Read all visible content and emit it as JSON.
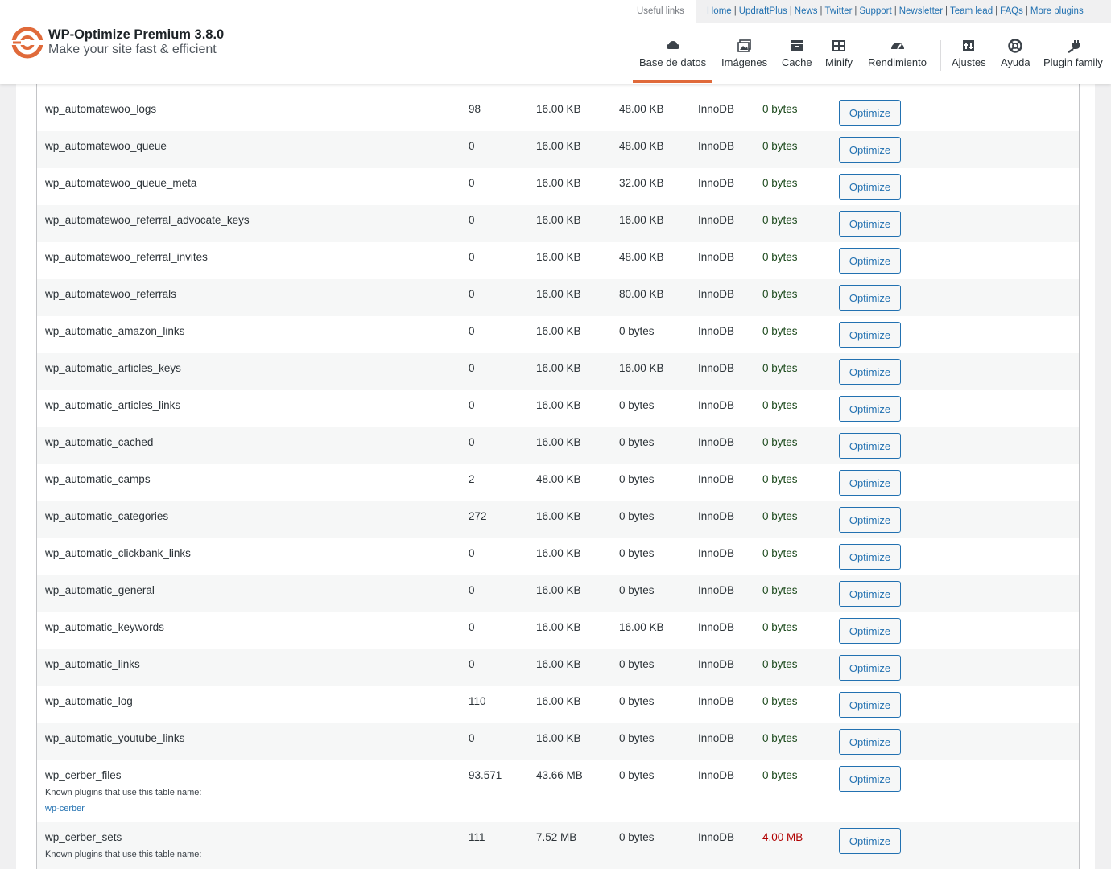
{
  "header": {
    "useful_links_label": "Useful links",
    "links": [
      "Home",
      "UpdraftPlus",
      "News",
      "Twitter",
      "Support",
      "Newsletter",
      "Team lead",
      "FAQs",
      "More plugins"
    ],
    "brand_title": "WP-Optimize Premium 3.8.0",
    "brand_subtitle": "Make your site fast & efficient",
    "tabs": [
      {
        "label": "Base de datos",
        "icon": "database-icon"
      },
      {
        "label": "Imágenes",
        "icon": "images-icon"
      },
      {
        "label": "Cache",
        "icon": "cache-icon"
      },
      {
        "label": "Minify",
        "icon": "minify-icon"
      },
      {
        "label": "Rendimiento",
        "icon": "performance-icon"
      },
      {
        "label": "Ajustes",
        "icon": "settings-icon"
      },
      {
        "label": "Ayuda",
        "icon": "help-icon"
      },
      {
        "label": "Plugin family",
        "icon": "plugin-icon"
      }
    ],
    "accent_color": "#e06a3a"
  },
  "table": {
    "button_label": "Optimize",
    "known_plugins_label": "Known plugins that use this table name:",
    "rows": [
      {
        "name": "wp_automatewoo_logs",
        "records": "98",
        "data": "16.00 KB",
        "index": "48.00 KB",
        "type": "InnoDB",
        "overhead": "0 bytes"
      },
      {
        "name": "wp_automatewoo_queue",
        "records": "0",
        "data": "16.00 KB",
        "index": "48.00 KB",
        "type": "InnoDB",
        "overhead": "0 bytes"
      },
      {
        "name": "wp_automatewoo_queue_meta",
        "records": "0",
        "data": "16.00 KB",
        "index": "32.00 KB",
        "type": "InnoDB",
        "overhead": "0 bytes"
      },
      {
        "name": "wp_automatewoo_referral_advocate_keys",
        "records": "0",
        "data": "16.00 KB",
        "index": "16.00 KB",
        "type": "InnoDB",
        "overhead": "0 bytes"
      },
      {
        "name": "wp_automatewoo_referral_invites",
        "records": "0",
        "data": "16.00 KB",
        "index": "48.00 KB",
        "type": "InnoDB",
        "overhead": "0 bytes"
      },
      {
        "name": "wp_automatewoo_referrals",
        "records": "0",
        "data": "16.00 KB",
        "index": "80.00 KB",
        "type": "InnoDB",
        "overhead": "0 bytes"
      },
      {
        "name": "wp_automatic_amazon_links",
        "records": "0",
        "data": "16.00 KB",
        "index": "0 bytes",
        "type": "InnoDB",
        "overhead": "0 bytes"
      },
      {
        "name": "wp_automatic_articles_keys",
        "records": "0",
        "data": "16.00 KB",
        "index": "16.00 KB",
        "type": "InnoDB",
        "overhead": "0 bytes"
      },
      {
        "name": "wp_automatic_articles_links",
        "records": "0",
        "data": "16.00 KB",
        "index": "0 bytes",
        "type": "InnoDB",
        "overhead": "0 bytes"
      },
      {
        "name": "wp_automatic_cached",
        "records": "0",
        "data": "16.00 KB",
        "index": "0 bytes",
        "type": "InnoDB",
        "overhead": "0 bytes"
      },
      {
        "name": "wp_automatic_camps",
        "records": "2",
        "data": "48.00 KB",
        "index": "0 bytes",
        "type": "InnoDB",
        "overhead": "0 bytes"
      },
      {
        "name": "wp_automatic_categories",
        "records": "272",
        "data": "16.00 KB",
        "index": "0 bytes",
        "type": "InnoDB",
        "overhead": "0 bytes"
      },
      {
        "name": "wp_automatic_clickbank_links",
        "records": "0",
        "data": "16.00 KB",
        "index": "0 bytes",
        "type": "InnoDB",
        "overhead": "0 bytes"
      },
      {
        "name": "wp_automatic_general",
        "records": "0",
        "data": "16.00 KB",
        "index": "0 bytes",
        "type": "InnoDB",
        "overhead": "0 bytes"
      },
      {
        "name": "wp_automatic_keywords",
        "records": "0",
        "data": "16.00 KB",
        "index": "16.00 KB",
        "type": "InnoDB",
        "overhead": "0 bytes"
      },
      {
        "name": "wp_automatic_links",
        "records": "0",
        "data": "16.00 KB",
        "index": "0 bytes",
        "type": "InnoDB",
        "overhead": "0 bytes"
      },
      {
        "name": "wp_automatic_log",
        "records": "110",
        "data": "16.00 KB",
        "index": "0 bytes",
        "type": "InnoDB",
        "overhead": "0 bytes"
      },
      {
        "name": "wp_automatic_youtube_links",
        "records": "0",
        "data": "16.00 KB",
        "index": "0 bytes",
        "type": "InnoDB",
        "overhead": "0 bytes"
      },
      {
        "name": "wp_cerber_files",
        "records": "93.571",
        "data": "43.66 MB",
        "index": "0 bytes",
        "type": "InnoDB",
        "overhead": "0 bytes",
        "plugin": "wp-cerber"
      },
      {
        "name": "wp_cerber_sets",
        "records": "111",
        "data": "7.52 MB",
        "index": "0 bytes",
        "type": "InnoDB",
        "overhead": "4.00 MB",
        "plugin": ""
      }
    ]
  }
}
